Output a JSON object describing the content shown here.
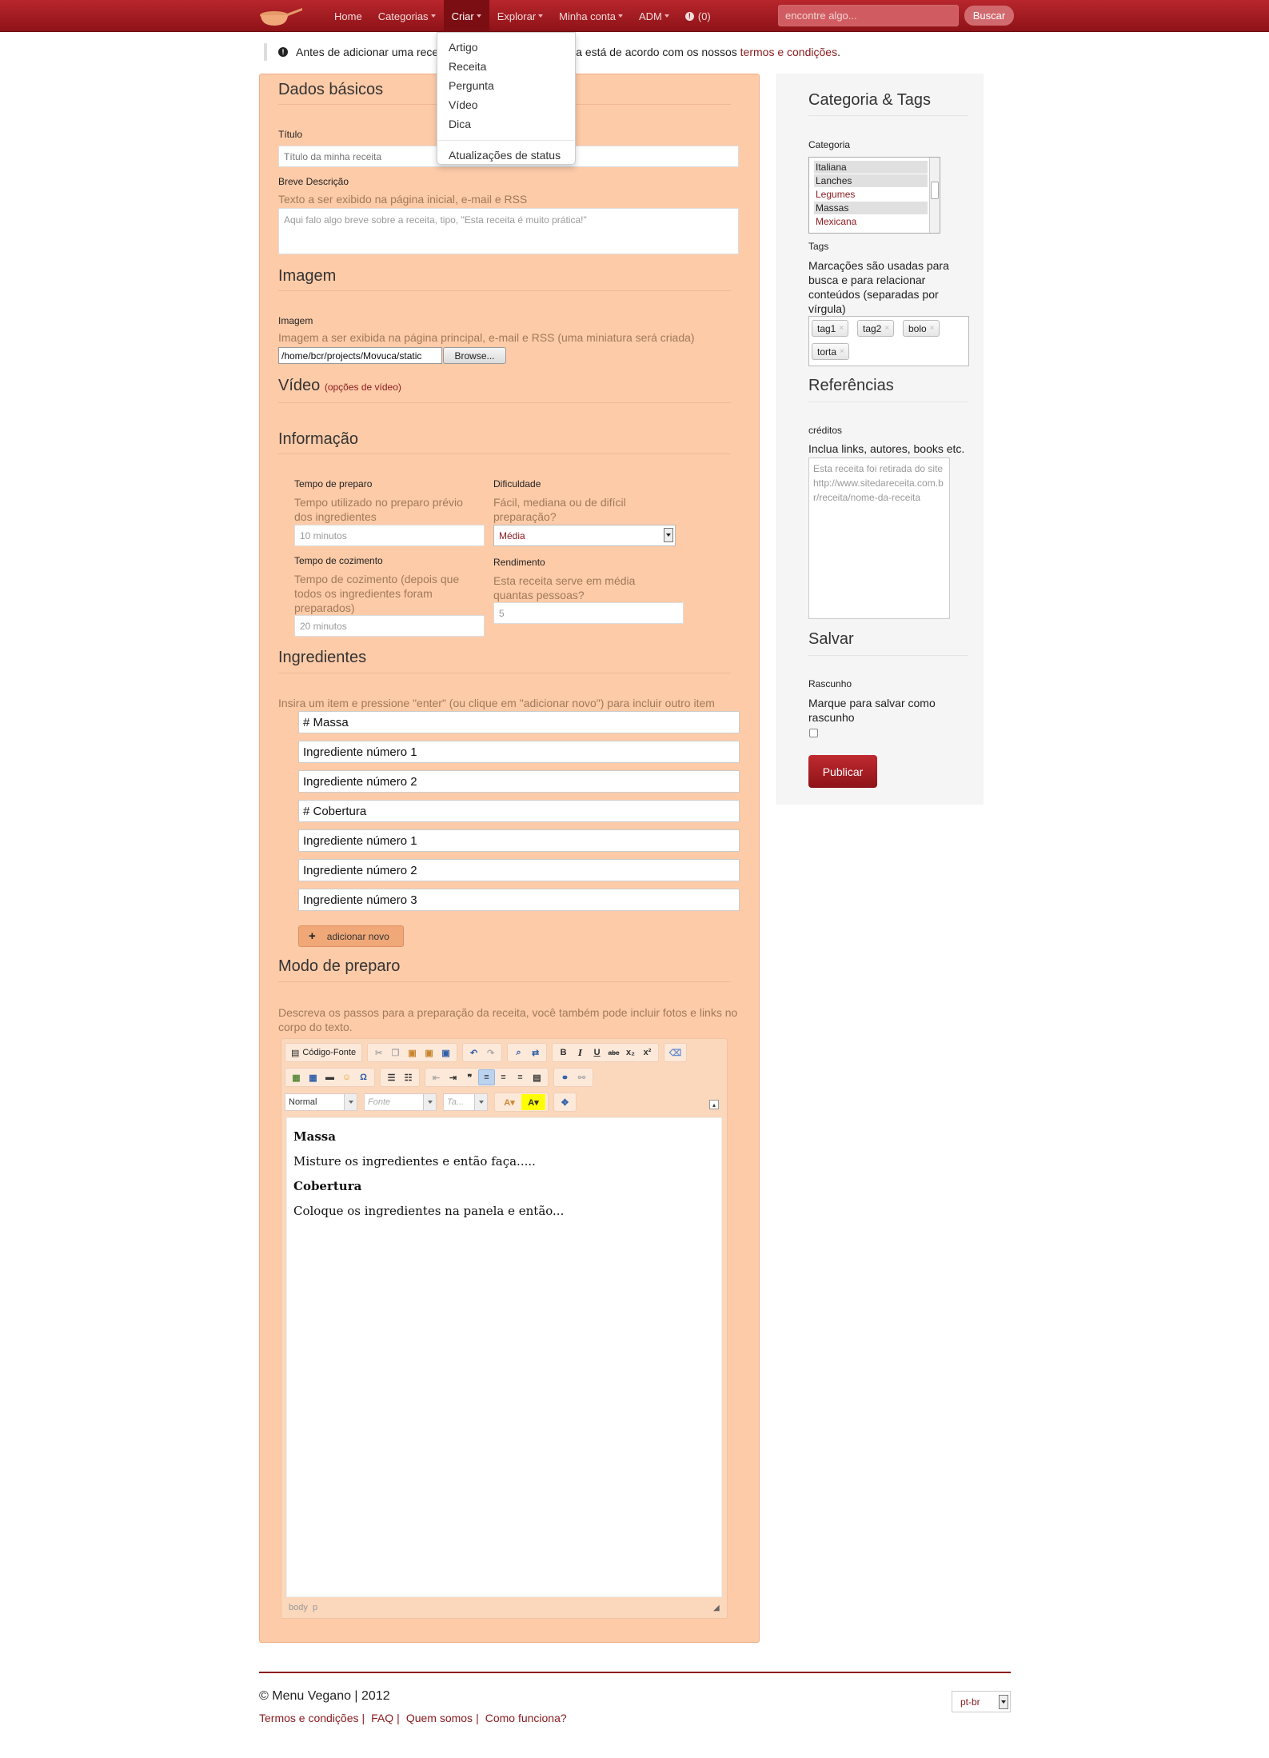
{
  "colors": {
    "brand": "#a11c22",
    "panel": "#fdcba8",
    "link": "#8b1a1e"
  },
  "nav": {
    "logo_icon": "cooking-pan-icon",
    "items": [
      "Home",
      "Categorias",
      "Criar",
      "Explorar",
      "Minha conta",
      "ADM"
    ],
    "notifications": "(0)",
    "search_placeholder": "encontre algo...",
    "search_button": "Buscar"
  },
  "dropdown": {
    "items": [
      "Artigo",
      "Receita",
      "Pergunta",
      "Vídeo",
      "Dica"
    ],
    "extra": "Atualizações de status"
  },
  "alert": {
    "text_before": "Antes de adicionar uma rece",
    "text_after": "a está de acordo com os nossos ",
    "link": "termos e condições",
    "end": "."
  },
  "basic": {
    "heading": "Dados básicos",
    "title_label": "Título",
    "title_placeholder": "Título da minha receita",
    "desc_label": "Breve Descrição",
    "desc_help": "Texto a ser exibido na página inicial, e-mail e RSS",
    "desc_placeholder": "Aqui falo algo breve sobre a receita, tipo, \"Esta receita é muito prática!\""
  },
  "image": {
    "heading": "Imagem",
    "label": "Imagem",
    "help": "Imagem a ser exibida na página principal, e-mail e RSS (uma miniatura será criada)",
    "file_path": "/home/bcr/projects/Movuca/static",
    "browse": "Browse..."
  },
  "video": {
    "heading": "Vídeo",
    "options": "(opções de vídeo)"
  },
  "info": {
    "heading": "Informação",
    "prep_label": "Tempo de preparo",
    "prep_help": "Tempo utilizado no preparo prévio dos ingredientes",
    "prep_value": "10 minutos",
    "diff_label": "Dificuldade",
    "diff_help": "Fácil, mediana ou de difícil preparação?",
    "diff_value": "Média",
    "cook_label": "Tempo de cozimento",
    "cook_help": "Tempo de cozimento (depois que todos os ingredientes foram preparados)",
    "cook_value": "20 minutos",
    "yield_label": "Rendimento",
    "yield_help": "Esta receita serve em média quantas pessoas?",
    "yield_value": "5"
  },
  "ingredients": {
    "heading": "Ingredientes",
    "help": "Insira um item e pressione \"enter\" (ou clique em \"adicionar novo\") para incluir outro item",
    "items": [
      "# Massa",
      "Ingrediente número 1",
      "Ingrediente número 2",
      "# Cobertura",
      "Ingrediente número 1",
      "Ingrediente número 2",
      "Ingrediente número 3"
    ],
    "add_button": "adicionar novo"
  },
  "method": {
    "heading": "Modo de preparo",
    "help": "Descreva os passos para a preparação da receita, você também pode incluir fotos e links no corpo do texto.",
    "toolbar": {
      "source": "Código-Fonte",
      "format": "Normal",
      "font": "Fonte",
      "size": "Ta..."
    },
    "body": {
      "h1": "Massa",
      "p1": "Misture os ingredientes e então faça.....",
      "h2": "Cobertura",
      "p2": "Coloque os ingredientes na panela e então..."
    },
    "status": "body  p"
  },
  "sidebar": {
    "cat_heading": "Categoria & Tags",
    "cat_label": "Categoria",
    "categories": [
      "Italiana",
      "Lanches",
      "Legumes",
      "Massas",
      "Mexicana"
    ],
    "tags_label": "Tags",
    "tags_help": "Marcações são usadas para busca e para relacionar conteúdos (separadas por vírgula)",
    "tags": [
      "tag1",
      "tag2",
      "bolo",
      "torta"
    ],
    "ref_heading": "Referências",
    "credits_label": "créditos",
    "credits_help": "Inclua links, autores, books etc.",
    "credits_placeholder": "Esta receita foi retirada do site http://www.sitedareceita.com.br/receita/nome-da-receita",
    "save_heading": "Salvar",
    "draft_label": "Rascunho",
    "draft_help": "Marque para salvar como rascunho",
    "publish": "Publicar"
  },
  "footer": {
    "copyright": "© Menu Vegano | 2012",
    "links": [
      "Termos e condições",
      "FAQ",
      "Quem somos",
      "Como funciona?"
    ],
    "language": "pt-br"
  }
}
